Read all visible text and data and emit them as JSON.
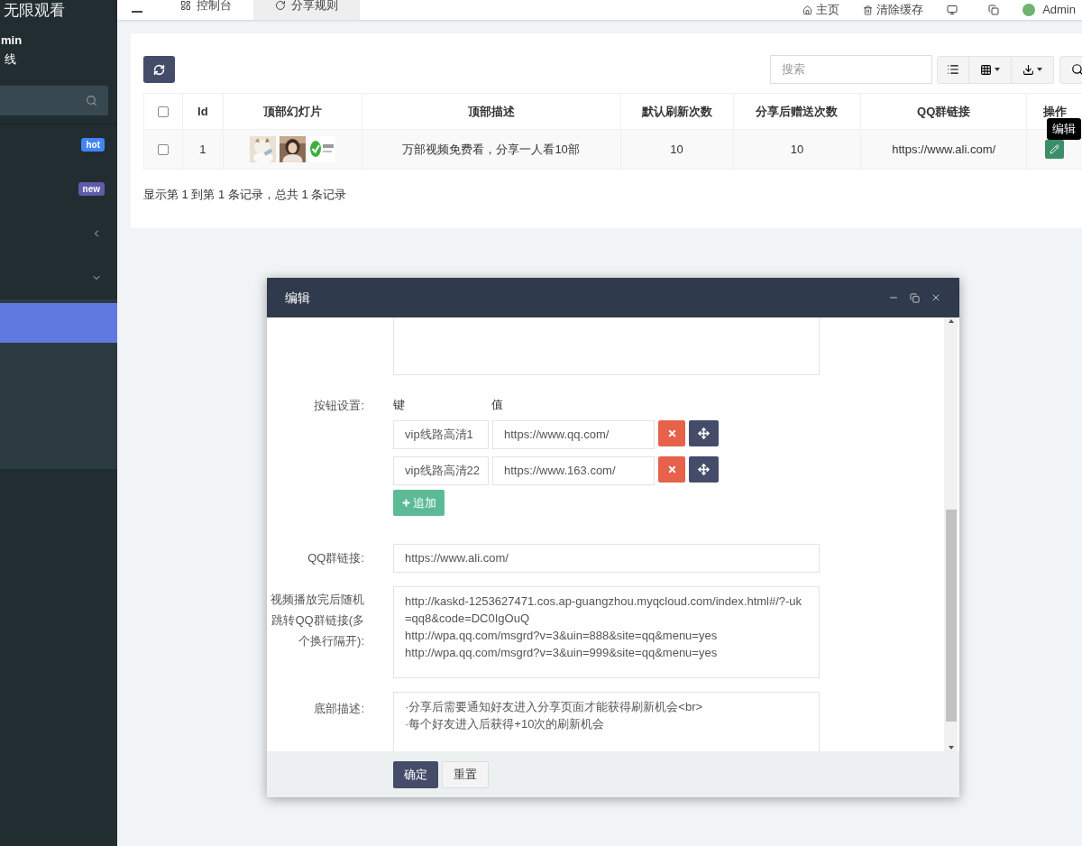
{
  "header": {
    "tabs": [
      {
        "label": "控制台",
        "selected": false
      },
      {
        "label": "分享规则",
        "selected": true
      }
    ],
    "links": [
      "主页",
      "清除缓存"
    ],
    "user": "Admin"
  },
  "sidebar": {
    "title": "无限观看",
    "user_name": "min",
    "status": "线",
    "menu": [
      {
        "kind": "badge",
        "badge": "hot",
        "color": "#4285f4"
      },
      {
        "kind": "badge",
        "badge": "new",
        "color": "#605ca8"
      },
      {
        "kind": "submenu",
        "expanded": false
      },
      {
        "kind": "submenu",
        "expanded": true
      },
      {
        "kind": "item",
        "selected": true
      }
    ]
  },
  "toolbar": {
    "search_placeholder": "搜索"
  },
  "table": {
    "columns": [
      "Id",
      "顶部幻灯片",
      "顶部描述",
      "默认刷新次数",
      "分享后赠送次数",
      "QQ群链接",
      "操作"
    ],
    "rows": [
      {
        "checked": false,
        "id": "1",
        "description": "万部视频免费看，分享一人看10部",
        "default_refresh": "10",
        "bonus": "10",
        "qq_link": "https://www.ali.com/"
      }
    ],
    "all_checked": false,
    "tooltip": "编辑",
    "footer": "显示第 1 到第 1 条记录，总共 1 条记录"
  },
  "dialog": {
    "title": "编辑",
    "button_settings": {
      "label": "按钮设置:",
      "key_header": "键",
      "value_header": "值",
      "rows": [
        {
          "key": "vip线路高清1",
          "value": "https://www.qq.com/"
        },
        {
          "key": "vip线路高清22",
          "value": "https://www.163.com/"
        }
      ],
      "add": "追加"
    },
    "qq_link": {
      "label": "QQ群链接:",
      "value": "https://www.ali.com/"
    },
    "redirect": {
      "label": "视频播放完后随机跳转QQ群链接(多个换行隔开):",
      "value": "http://kaskd-1253627471.cos.ap-guangzhou.myqcloud.com/index.html#/?-uk=qq8&code=DC0IgOuQ\nhttp://wpa.qq.com/msgrd?v=3&uin=888&site=qq&menu=yes\nhttp://wpa.qq.com/msgrd?v=3&uin=999&site=qq&menu=yes"
    },
    "bottom_desc": {
      "label": "底部描述:",
      "value": "·分享后需要通知好友进入分享页面才能获得刷新机会<br>\n·每个好友进入后获得+10次的刷新机会"
    },
    "buttons": [
      "确定",
      "重置"
    ]
  }
}
